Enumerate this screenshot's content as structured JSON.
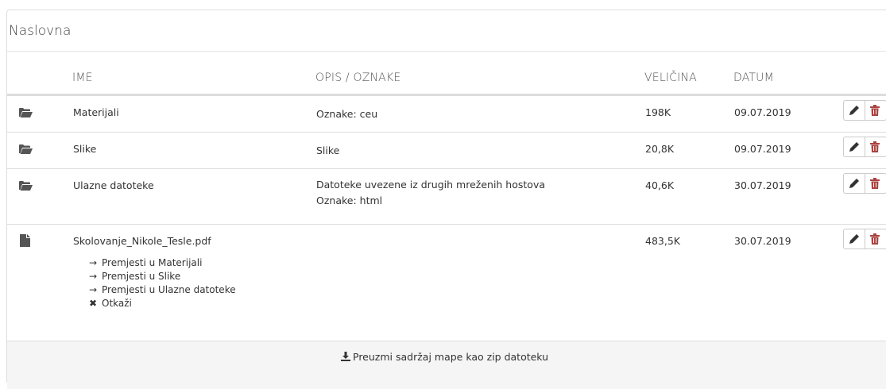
{
  "panel": {
    "title": "Naslovna"
  },
  "table": {
    "headers": {
      "name": "IME",
      "description": "OPIS / OZNAKE",
      "size": "VELIČINA",
      "date": "DATUM"
    },
    "rows": [
      {
        "type": "folder",
        "icon": "folder-open-icon",
        "name": "Materijali",
        "description": [
          "Oznake: ceu"
        ],
        "size": "198K",
        "date": "09.07.2019"
      },
      {
        "type": "folder",
        "icon": "folder-open-icon",
        "name": "Slike",
        "description": [
          "Slike"
        ],
        "size": "20,8K",
        "date": "09.07.2019"
      },
      {
        "type": "folder",
        "icon": "folder-open-icon",
        "name": "Ulazne datoteke",
        "description": [
          "Datoteke uvezene iz drugih mreženih hostova",
          "Oznake: html"
        ],
        "size": "40,6K",
        "date": "30.07.2019"
      },
      {
        "type": "file",
        "icon": "file-icon",
        "name": "Skolovanje_Nikole_Tesle.pdf",
        "description": [],
        "size": "483,5K",
        "date": "30.07.2019",
        "move_options": [
          "Premjesti u Materijali",
          "Premjesti u Slike",
          "Premjesti u Ulazne datoteke"
        ],
        "cancel_label": "Otkaži"
      }
    ]
  },
  "footer": {
    "download_label": "Preuzmi sadržaj mape kao zip datoteku"
  },
  "colors": {
    "delete": "#a94442",
    "icon": "#555555",
    "footer_bg": "#f5f5f5",
    "border": "#dddddd"
  }
}
